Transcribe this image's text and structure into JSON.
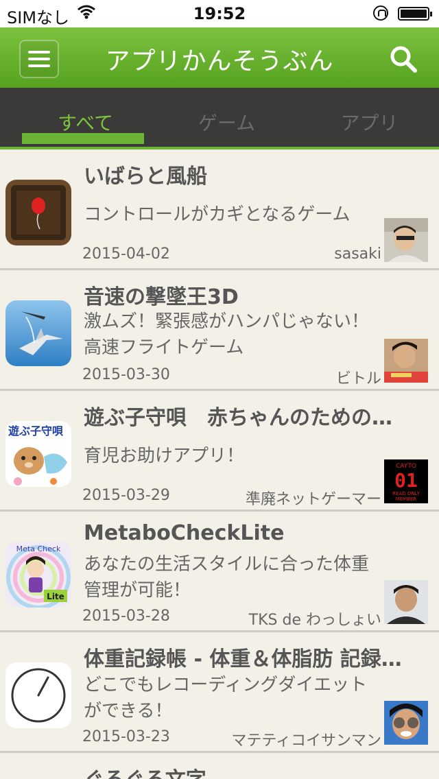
{
  "status_bar": {
    "carrier": "SIMなし",
    "time": "19:52"
  },
  "nav": {
    "title": "アプリかんそうぶん"
  },
  "tabs": [
    {
      "label": "すべて",
      "active": true
    },
    {
      "label": "ゲーム",
      "active": false
    },
    {
      "label": "アプリ",
      "active": false
    }
  ],
  "items": [
    {
      "title": "いばらと風船",
      "description": "コントロールがカギとなるゲーム",
      "date": "2015-04-02",
      "user": "sasaki"
    },
    {
      "title": "音速の撃墜王3D",
      "description": "激ムズ！緊張感がハンパじゃない！高速フライトゲーム",
      "date": "2015-03-30",
      "user": "ビトル"
    },
    {
      "title": "遊ぶ子守唄　赤ちゃんのための…",
      "description": "育児お助けアプリ！",
      "date": "2015-03-29",
      "user": "準廃ネットゲーマー"
    },
    {
      "title": "MetaboCheckLite",
      "description": "あなたの生活スタイルに合った体重管理が可能！",
      "date": "2015-03-28",
      "user": "TKS de わっしょい"
    },
    {
      "title": "体重記録帳 - 体重＆体脂肪 記録…",
      "description": "どこでもレコーディングダイエットができる！",
      "date": "2015-03-23",
      "user": "マテティコイサンマン"
    }
  ],
  "partial_item": {
    "title": "ぐるぐる文字"
  },
  "icon_text": {
    "lullaby": "遊ぶ子守唄",
    "cayto_brand": "CAYTO",
    "cayto_num": "01",
    "cayto_sub1": "READ ONLY",
    "cayto_sub2": "MEMBER",
    "metabo_title": "Meta Check",
    "metabo_badge": "Lite"
  },
  "colors": {
    "nav_green": "#6cb434",
    "tab_active": "#7ec43f",
    "tab_bar_bg": "#3a3a38",
    "list_bg": "#f2f0e7"
  }
}
